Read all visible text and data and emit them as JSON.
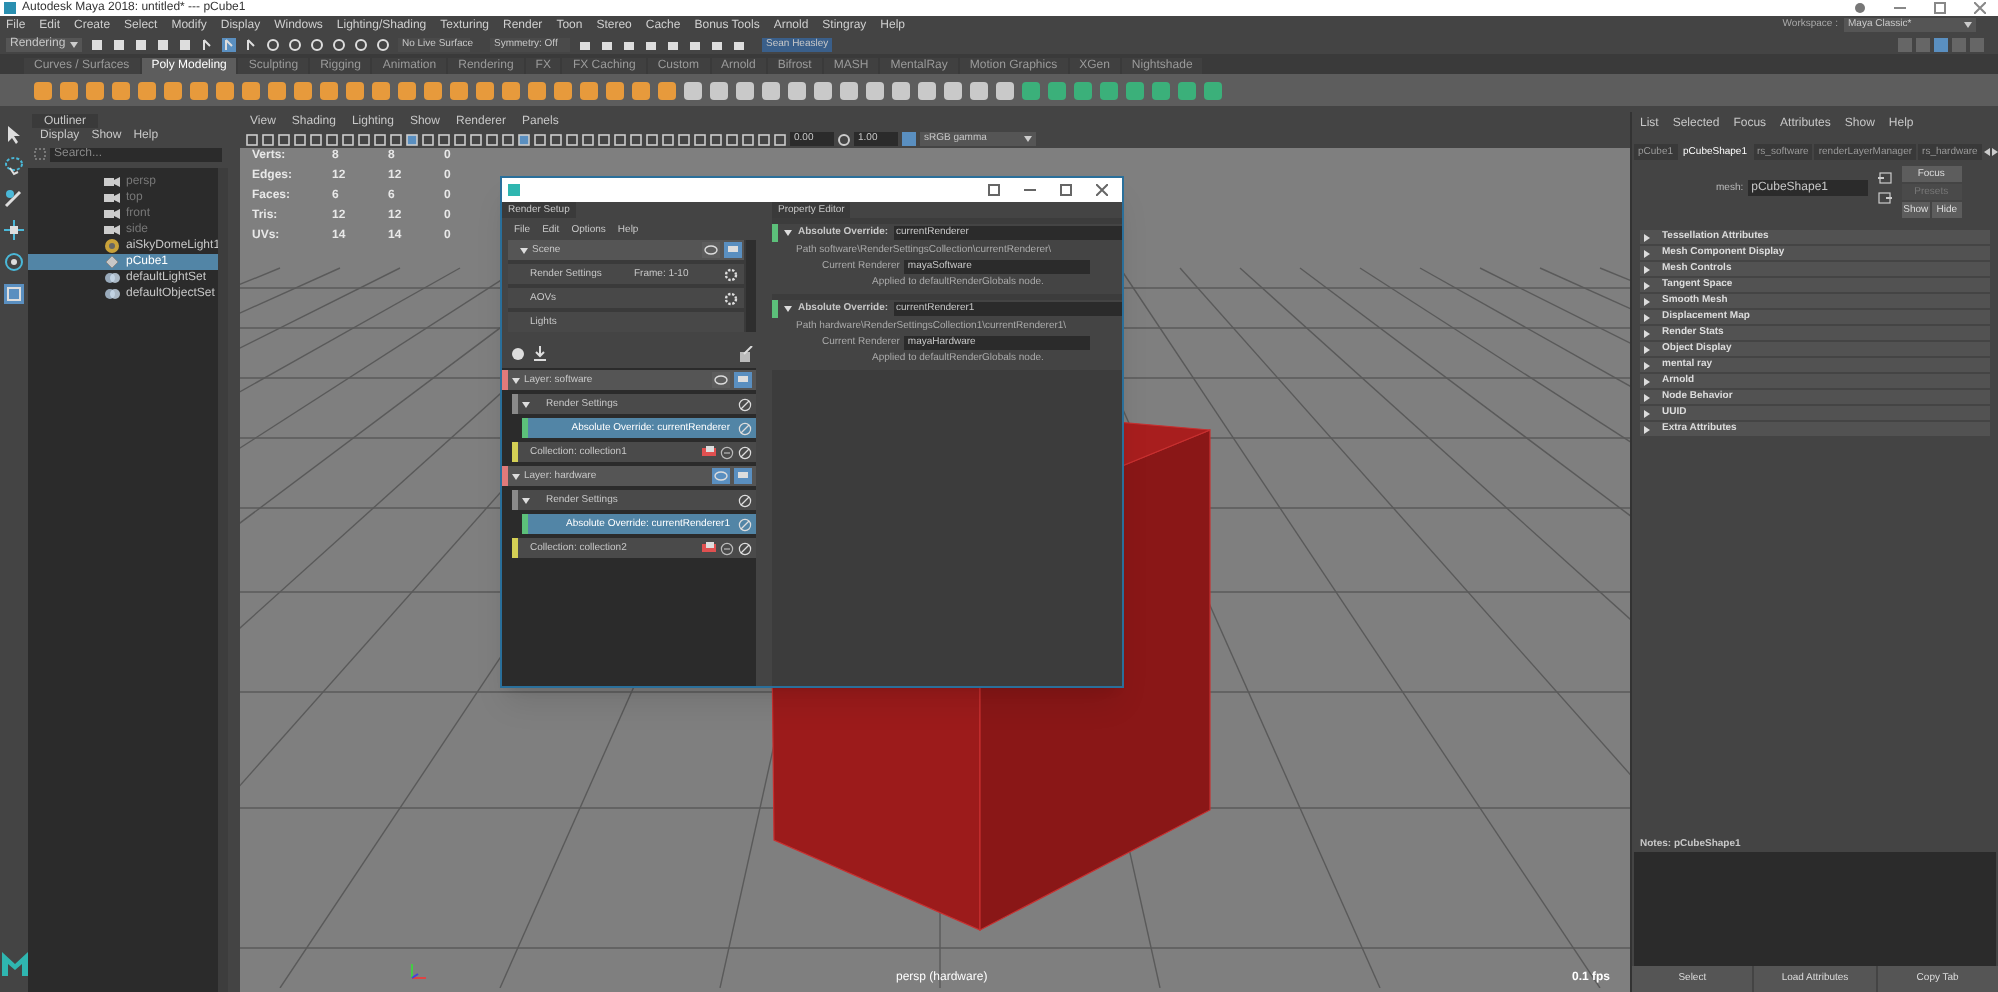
{
  "window": {
    "title": "Autodesk Maya 2018: untitled*   ---   pCube1"
  },
  "menu_bar": [
    "File",
    "Edit",
    "Create",
    "Select",
    "Modify",
    "Display",
    "Windows",
    "Lighting/Shading",
    "Texturing",
    "Render",
    "Toon",
    "Stereo",
    "Cache",
    "Bonus Tools",
    "Arnold",
    "Stingray",
    "Help"
  ],
  "workspace": {
    "label": "Workspace :",
    "value": "Maya Classic*"
  },
  "status_line": {
    "mode": "Rendering",
    "live_surface": "No Live Surface",
    "symmetry": "Symmetry: Off",
    "user": "Sean Heasley"
  },
  "shelf": {
    "tabs": [
      {
        "label": "Curves / Surfaces",
        "selected": false
      },
      {
        "label": "Poly Modeling",
        "selected": true
      },
      {
        "label": "Sculpting",
        "selected": false
      },
      {
        "label": "Rigging",
        "selected": false
      },
      {
        "label": "Animation",
        "selected": false
      },
      {
        "label": "Rendering",
        "selected": false
      },
      {
        "label": "FX",
        "selected": false
      },
      {
        "label": "FX Caching",
        "selected": false
      },
      {
        "label": "Custom",
        "selected": false
      },
      {
        "label": "Arnold",
        "selected": false
      },
      {
        "label": "Bifrost",
        "selected": false
      },
      {
        "label": "MASH",
        "selected": false
      },
      {
        "label": "MentalRay",
        "selected": false
      },
      {
        "label": "Motion Graphics",
        "selected": false
      },
      {
        "label": "XGen",
        "selected": false
      },
      {
        "label": "Nightshade",
        "selected": false
      }
    ]
  },
  "outliner": {
    "title": "Outliner",
    "menu": [
      "Display",
      "Show",
      "Help"
    ],
    "search": {
      "placeholder": "Search..."
    },
    "items": [
      {
        "label": "persp",
        "kind": "camera",
        "dimmed": true,
        "selected": false
      },
      {
        "label": "top",
        "kind": "camera",
        "dimmed": true,
        "selected": false
      },
      {
        "label": "front",
        "kind": "camera",
        "dimmed": true,
        "selected": false
      },
      {
        "label": "side",
        "kind": "camera",
        "dimmed": true,
        "selected": false
      },
      {
        "label": "aiSkyDomeLight1",
        "kind": "light",
        "dimmed": false,
        "selected": false
      },
      {
        "label": "pCube1",
        "kind": "mesh",
        "dimmed": false,
        "selected": true
      },
      {
        "label": "defaultLightSet",
        "kind": "set",
        "dimmed": false,
        "selected": false
      },
      {
        "label": "defaultObjectSet",
        "kind": "set",
        "dimmed": false,
        "selected": false
      }
    ]
  },
  "viewport": {
    "menu": [
      "View",
      "Shading",
      "Lighting",
      "Show",
      "Renderer",
      "Panels"
    ],
    "exposure": "0.00",
    "gamma": "1.00",
    "color_space": "sRGB gamma",
    "hud": [
      {
        "label": "Verts:",
        "values": [
          "8",
          "8",
          "0"
        ]
      },
      {
        "label": "Edges:",
        "values": [
          "12",
          "12",
          "0"
        ]
      },
      {
        "label": "Faces:",
        "values": [
          "6",
          "6",
          "0"
        ]
      },
      {
        "label": "Tris:",
        "values": [
          "12",
          "12",
          "0"
        ]
      },
      {
        "label": "UVs:",
        "values": [
          "14",
          "14",
          "0"
        ]
      }
    ],
    "camera": "persp (hardware)",
    "fps": "0.1 fps"
  },
  "render_setup": {
    "tab": "Render Setup",
    "menu": [
      "File",
      "Edit",
      "Options",
      "Help"
    ],
    "scene": {
      "label": "Scene",
      "visible": false,
      "renderable": true,
      "rows": [
        {
          "label": "Render Settings",
          "value": "Frame: 1-10"
        },
        {
          "label": "AOVs"
        },
        {
          "label": "Lights"
        }
      ]
    },
    "layers": [
      {
        "label": "Layer:  software",
        "visible": false,
        "renderable": true,
        "children": [
          {
            "kind": "settings",
            "label": "Render Settings",
            "selected": false
          },
          {
            "kind": "override",
            "label": "Absolute Override:  currentRenderer",
            "selected": true
          },
          {
            "kind": "collection",
            "label": "Collection:  collection1",
            "selected": false
          }
        ]
      },
      {
        "label": "Layer:  hardware",
        "visible": true,
        "renderable": true,
        "children": [
          {
            "kind": "settings",
            "label": "Render Settings",
            "selected": false
          },
          {
            "kind": "override",
            "label": "Absolute Override:  currentRenderer1",
            "selected": true
          },
          {
            "kind": "collection",
            "label": "Collection:  collection2",
            "selected": false
          }
        ]
      }
    ]
  },
  "property_editor": {
    "tab": "Property Editor",
    "overrides": [
      {
        "label": "Absolute Override:",
        "value": "currentRenderer",
        "path": "Path software\\RenderSettingsCollection\\currentRenderer\\",
        "field_label": "Current Renderer",
        "field_value": "mayaSoftware",
        "note": "Applied to defaultRenderGlobals node."
      },
      {
        "label": "Absolute Override:",
        "value": "currentRenderer1",
        "path": "Path hardware\\RenderSettingsCollection1\\currentRenderer1\\",
        "field_label": "Current Renderer",
        "field_value": "mayaHardware",
        "note": "Applied to defaultRenderGlobals node."
      }
    ]
  },
  "attribute_editor": {
    "menu": [
      "List",
      "Selected",
      "Focus",
      "Attributes",
      "Show",
      "Help"
    ],
    "tabs": [
      {
        "label": "pCube1",
        "selected": false
      },
      {
        "label": "pCubeShape1",
        "selected": true
      },
      {
        "label": "rs_software",
        "selected": false
      },
      {
        "label": "renderLayerManager",
        "selected": false
      },
      {
        "label": "rs_hardware",
        "selected": false
      }
    ],
    "node_type": "mesh:",
    "node_name": "pCubeShape1",
    "buttons": [
      {
        "label": "Focus",
        "disabled": false
      },
      {
        "label": "Presets",
        "disabled": true
      },
      {
        "label": "Show",
        "disabled": false
      },
      {
        "label": "Hide",
        "disabled": false
      }
    ],
    "sections": [
      "Tessellation Attributes",
      "Mesh Component Display",
      "Mesh Controls",
      "Tangent Space",
      "Smooth Mesh",
      "Displacement Map",
      "Render Stats",
      "Object Display",
      "mental ray",
      "Arnold",
      "Node Behavior",
      "UUID",
      "Extra Attributes"
    ],
    "notes": "Notes:  pCubeShape1",
    "bottom_buttons": [
      "Select",
      "Load Attributes",
      "Copy Tab"
    ]
  }
}
